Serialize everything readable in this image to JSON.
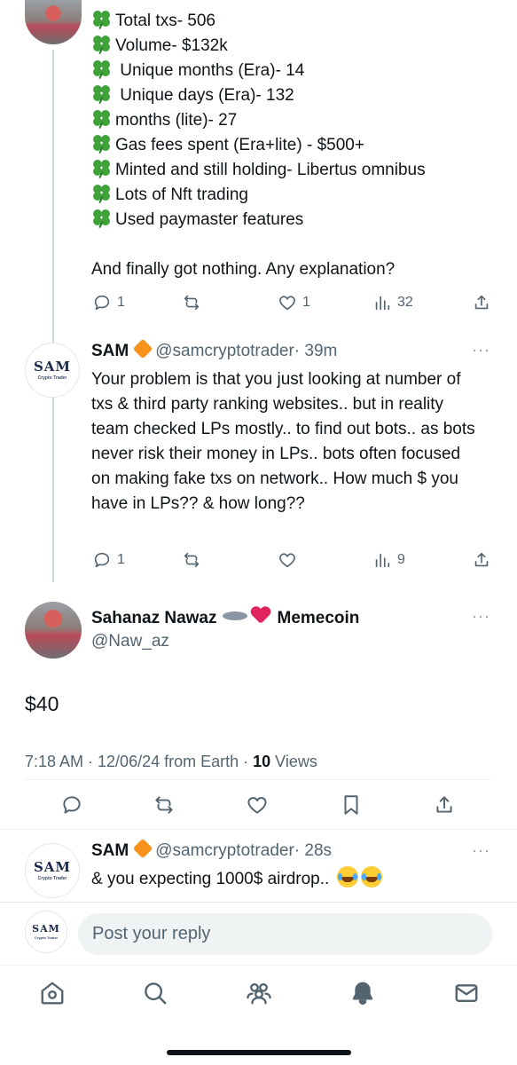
{
  "tweet_top": {
    "lines": [
      "Total txs- 506",
      "Volume- $132k",
      " Unique months (Era)- 14",
      " Unique days (Era)- 132",
      "months (lite)- 27",
      "Gas fees spent (Era+lite) - $500+",
      "Minted and still holding- Libertus omnibus",
      "Lots of Nft trading",
      "Used paymaster features"
    ],
    "closing": "And finally got nothing. Any explanation?",
    "replies": "1",
    "likes": "1",
    "views": "32"
  },
  "reply_sam_1": {
    "name": "SAM",
    "handle": "@samcryptotrader",
    "time": "· 39m",
    "text": "Your problem is that you just looking at number of txs & third party ranking websites.. but in reality team checked LPs mostly.. to find out bots.. as bots never risk their money in LPs.. bots often focused on making fake txs on network.. How much $ you have in LPs?? & how long??",
    "replies": "1",
    "views": "9",
    "logo": "SAM",
    "logo_sub": "Crypto Trader"
  },
  "main_tweet": {
    "name_part1": "Sahanaz Nawaz",
    "name_part2": "Memecoin",
    "handle": "@Naw_az",
    "text": "$40",
    "time_date": "7:18 AM · 12/06/24 from Earth · ",
    "views_count": "10",
    "views_label": " Views"
  },
  "reply_sam_2": {
    "name": "SAM",
    "handle": "@samcryptotrader",
    "time": "· 28s",
    "text": "& you expecting 1000$ airdrop.."
  },
  "composer": {
    "placeholder": "Post your reply"
  },
  "more_icon": "···",
  "colors": {
    "accent": "#1d9bf0",
    "text": "#0f1419",
    "muted": "#536471",
    "orange": "#f7931a"
  }
}
